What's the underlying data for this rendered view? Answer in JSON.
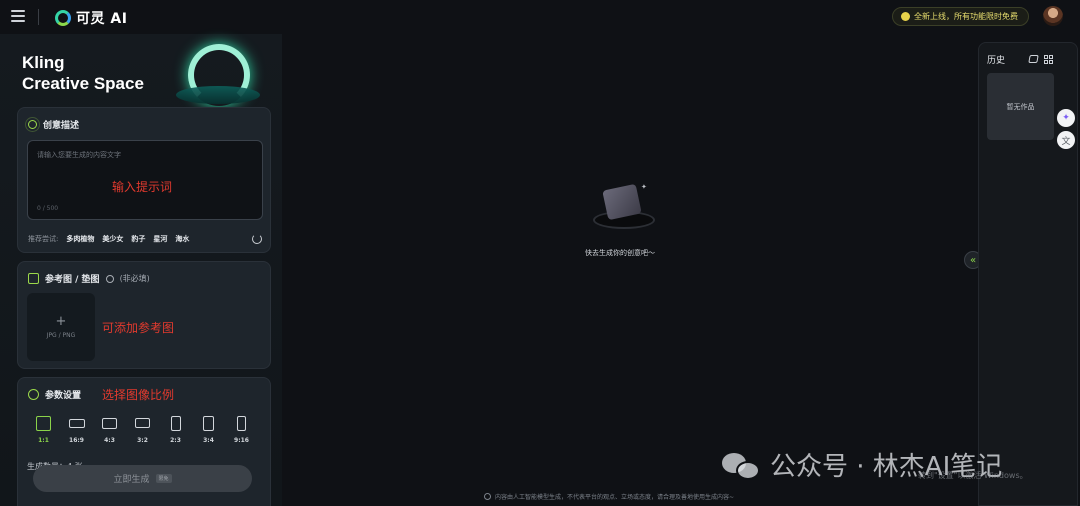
{
  "header": {
    "logo_text": "可灵 AI",
    "notice": "全新上线，所有功能限时免费"
  },
  "hero": {
    "title_line1": "Kling",
    "title_line2": "Creative Space"
  },
  "prompt_card": {
    "title": "创意描述",
    "placeholder": "请输入您要生成的内容文字",
    "counter": "0 / 500",
    "annotation": "输入提示词",
    "suggest_label": "推荐尝试:",
    "suggestions": [
      "多肉植物",
      "美少女",
      "豹子",
      "星河",
      "海水"
    ]
  },
  "reference_card": {
    "title": "参考图 / 垫图",
    "optional": "(非必填)",
    "upload_hint": "JPG / PNG",
    "annotation": "可添加参考图"
  },
  "params_card": {
    "title": "参数设置",
    "annotation": "选择图像比例",
    "ratios": [
      "1:1",
      "16:9",
      "4:3",
      "3:2",
      "2:3",
      "3:4",
      "9:16"
    ],
    "selected_ratio": "1:1",
    "gen_count": "生成数量：4 张"
  },
  "generate": {
    "label": "立即生成",
    "badge": "限免"
  },
  "center": {
    "empty_text": "快去生成你的创意吧～"
  },
  "history": {
    "title": "历史",
    "empty": "暂无作品"
  },
  "footer": {
    "note": "内容由人工智能模型生成，不代表平台的观点、立场或态度，请合理及善地使用生成内容~"
  },
  "overlay": {
    "watermark": "公众号 · 林杰AI笔记",
    "windows_text": "转到\"设置\"以激活 Windows。"
  },
  "colors": {
    "accent": "#8bd34a",
    "annotation": "#e23a2e",
    "background": "#0f1115"
  }
}
